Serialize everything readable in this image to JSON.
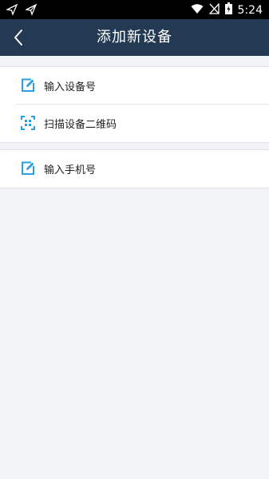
{
  "status_bar": {
    "time": "5:24",
    "icons": [
      "send-icon",
      "send-outline-icon",
      "wifi-icon",
      "no-signal-icon",
      "battery-charging-icon"
    ]
  },
  "header": {
    "title": "添加新设备",
    "back_icon": "chevron-left-icon"
  },
  "menu": {
    "group1": [
      {
        "label": "输入设备号",
        "icon": "edit-icon"
      },
      {
        "label": "扫描设备二维码",
        "icon": "qr-scan-icon"
      }
    ],
    "group2": [
      {
        "label": "输入手机号",
        "icon": "edit-icon"
      }
    ]
  },
  "colors": {
    "header_bg": "#243a53",
    "accent": "#2b9fe0",
    "page_bg": "#f2f3f7"
  }
}
